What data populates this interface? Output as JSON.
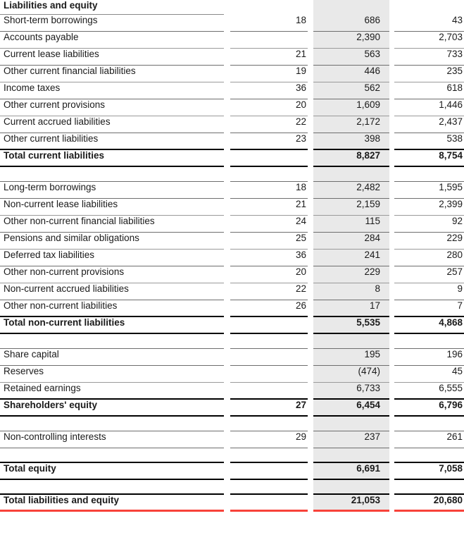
{
  "table": {
    "header_label": "Liabilities and equity",
    "columns": {
      "label": "Liabilities and equity",
      "note": "",
      "current": "",
      "previous": ""
    },
    "colors": {
      "shade": "#e9e9e9",
      "accent_red": "#f8423a",
      "rule_dark": "#000000",
      "rule_light": "#9a9a9a",
      "text": "#1a1a1a"
    },
    "sections": [
      {
        "id": "current-liabilities",
        "rows": [
          {
            "label": "Short-term borrowings",
            "note": "18",
            "current": "686",
            "previous": "43"
          },
          {
            "label": "Accounts payable",
            "note": "",
            "current": "2,390",
            "previous": "2,703"
          },
          {
            "label": "Current lease liabilities",
            "note": "21",
            "current": "563",
            "previous": "733"
          },
          {
            "label": "Other current financial liabilities",
            "note": "19",
            "current": "446",
            "previous": "235"
          },
          {
            "label": "Income taxes",
            "note": "36",
            "current": "562",
            "previous": "618"
          },
          {
            "label": "Other current provisions",
            "note": "20",
            "current": "1,609",
            "previous": "1,446"
          },
          {
            "label": "Current accrued liabilities",
            "note": "22",
            "current": "2,172",
            "previous": "2,437"
          },
          {
            "label": "Other current liabilities",
            "note": "23",
            "current": "398",
            "previous": "538"
          }
        ],
        "total": {
          "label": "Total current liabilities",
          "note": "",
          "current": "8,827",
          "previous": "8,754"
        }
      },
      {
        "id": "non-current-liabilities",
        "rows": [
          {
            "label": "Long-term borrowings",
            "note": "18",
            "current": "2,482",
            "previous": "1,595"
          },
          {
            "label": "Non-current lease liabilities",
            "note": "21",
            "current": "2,159",
            "previous": "2,399"
          },
          {
            "label": "Other non-current financial liabilities",
            "note": "24",
            "current": "115",
            "previous": "92"
          },
          {
            "label": "Pensions and similar obligations",
            "note": "25",
            "current": "284",
            "previous": "229"
          },
          {
            "label": "Deferred tax liabilities",
            "note": "36",
            "current": "241",
            "previous": "280"
          },
          {
            "label": "Other non-current provisions",
            "note": "20",
            "current": "229",
            "previous": "257"
          },
          {
            "label": "Non-current accrued liabilities",
            "note": "22",
            "current": "8",
            "previous": "9"
          },
          {
            "label": "Other non-current liabilities",
            "note": "26",
            "current": "17",
            "previous": "7"
          }
        ],
        "total": {
          "label": "Total non-current liabilities",
          "note": "",
          "current": "5,535",
          "previous": "4,868"
        }
      },
      {
        "id": "shareholders-equity",
        "rows": [
          {
            "label": "Share capital",
            "note": "",
            "current": "195",
            "previous": "196"
          },
          {
            "label": "Reserves",
            "note": "",
            "current": "(474)",
            "previous": "45"
          },
          {
            "label": "Retained earnings",
            "note": "",
            "current": "6,733",
            "previous": "6,555"
          }
        ],
        "total": {
          "label": "Shareholders' equity",
          "note": "27",
          "current": "6,454",
          "previous": "6,796"
        }
      },
      {
        "id": "non-controlling-interests",
        "rows": [
          {
            "label": "Non-controlling interests",
            "note": "29",
            "current": "237",
            "previous": "261"
          }
        ],
        "total": null
      }
    ],
    "grand_totals": [
      {
        "id": "total-equity",
        "label": "Total equity",
        "note": "",
        "current": "6,691",
        "previous": "7,058"
      },
      {
        "id": "total-liabilities-and-equity",
        "label": "Total liabilities and equity",
        "note": "",
        "current": "21,053",
        "previous": "20,680"
      }
    ]
  }
}
